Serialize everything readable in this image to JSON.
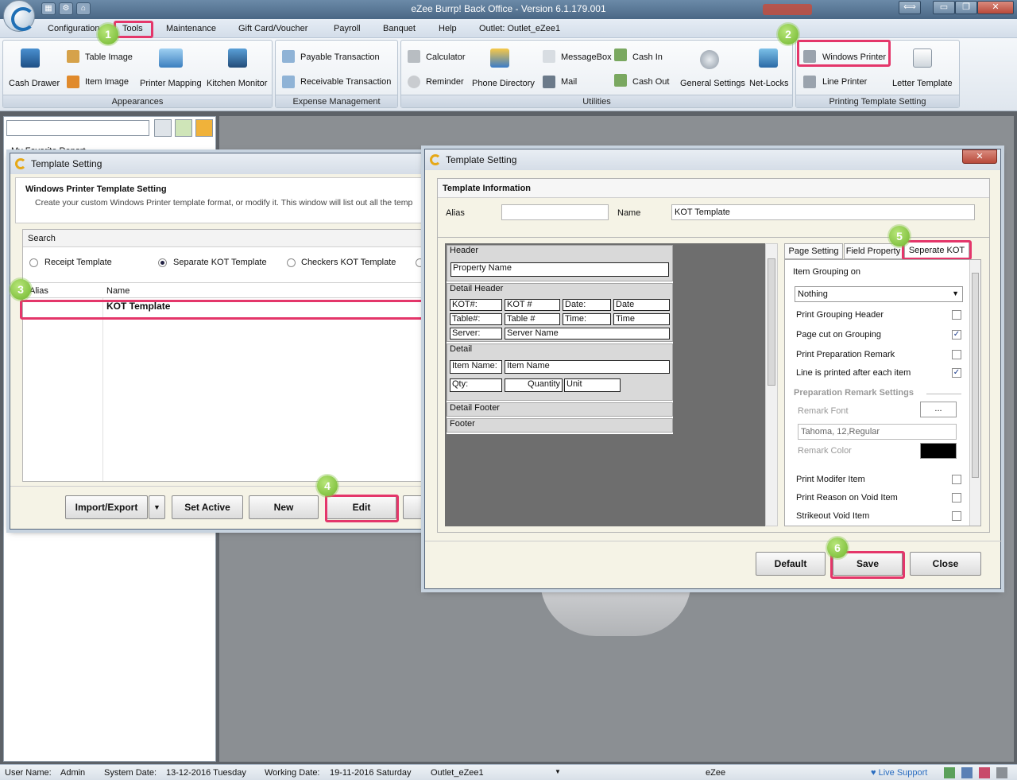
{
  "window": {
    "title": "eZee Burrp! Back Office - Version 6.1.179.001",
    "min": "▭",
    "restore": "❐",
    "close": "✕",
    "resize": "⟺"
  },
  "menubar": {
    "items": [
      "Configuration",
      "Tools",
      "Maintenance",
      "Gift Card/Voucher",
      "Payroll",
      "Banquet",
      "Help",
      "Outlet: Outlet_eZee1"
    ]
  },
  "ribbon": {
    "appearances": {
      "label": "Appearances",
      "items": [
        "Cash Drawer",
        "Table Image",
        "Item Image",
        "Printer Mapping",
        "Kitchen Monitor"
      ]
    },
    "expense": {
      "label": "Expense Management",
      "items": [
        "Payable Transaction",
        "Receivable Transaction"
      ]
    },
    "utilities": {
      "label": "Utilities",
      "items": [
        "Calculator",
        "Reminder",
        "Phone Directory",
        "MessageBox",
        "Mail",
        "Cash In",
        "Cash Out",
        "General Settings",
        "Net-Locks"
      ]
    },
    "printing": {
      "label": "Printing Template Setting",
      "items": [
        "Windows Printer",
        "Line Printer",
        "Letter Template"
      ]
    }
  },
  "left_panel": {
    "tree_item": "My Favorite Report"
  },
  "dialog1": {
    "title": "Template Setting",
    "heading": "Windows Printer Template Setting",
    "description": "Create your custom Windows Printer template format, or modify it. This window will list out all the temp",
    "search_label": "Search",
    "radios": [
      "Receipt Template",
      "Separate KOT Template",
      "Checkers KOT Template"
    ],
    "columns": [
      "Alias",
      "Name"
    ],
    "rows": [
      {
        "alias": "",
        "name": "KOT Template"
      }
    ],
    "buttons": [
      "Import/Export",
      "Set Active",
      "New",
      "Edit"
    ]
  },
  "dialog2": {
    "title": "Template Setting",
    "section": "Template Information",
    "alias_label": "Alias",
    "alias_value": "",
    "name_label": "Name",
    "name_value": "KOT Template",
    "template": {
      "header": "Header",
      "property_name": "Property Name",
      "detail_header": "Detail Header",
      "kot_label": "KOT#:",
      "kot_value": "KOT #",
      "date_label": "Date:",
      "date_value": "Date",
      "table_label": "Table#:",
      "table_value": "Table #",
      "time_label": "Time:",
      "time_value": "Time",
      "server_label": "Server:",
      "server_value": "Server Name",
      "detail": "Detail",
      "item_label": "Item Name:",
      "item_value": "Item Name",
      "qty_label": "Qty:",
      "qty_value": "Quantity",
      "unit_value": "Unit",
      "detail_footer": "Detail Footer",
      "footer": "Footer"
    },
    "tabs": [
      "Page Setting",
      "Field Property",
      "Seperate KOT"
    ],
    "props": {
      "grouping_label": "Item Grouping on",
      "grouping_value": "Nothing",
      "print_grouping_header": "Print Grouping Header",
      "page_cut": "Page cut on Grouping",
      "print_prep": "Print Preparation Remark",
      "line_printed": "Line is printed after each item",
      "prep_section": "Preparation Remark Settings",
      "remark_font": "Remark Font",
      "font_btn": "...",
      "font_value": "Tahoma, 12,Regular",
      "remark_color": "Remark Color",
      "print_modifier": "Print Modifer Item",
      "print_reason": "Print Reason on Void Item",
      "strikeout": "Strikeout Void Item"
    },
    "checks": {
      "print_grouping_header": false,
      "page_cut": true,
      "print_prep": false,
      "line_printed": true,
      "print_modifier": false,
      "print_reason": false,
      "strikeout": false
    },
    "buttons": [
      "Default",
      "Save",
      "Close"
    ]
  },
  "badges": [
    "1",
    "2",
    "3",
    "4",
    "5",
    "6"
  ],
  "status": {
    "user_label": "User Name:",
    "user": "Admin",
    "sysdate_label": "System Date:",
    "sysdate": "13-12-2016 Tuesday",
    "workdate_label": "Working Date:",
    "workdate": "19-11-2016 Saturday",
    "outlet": "Outlet_eZee1",
    "center": "eZee",
    "live_support": "Live Support"
  },
  "colors": {
    "highlight": "#e4366a",
    "badge": "#8cc84b",
    "titlebar": "#5a7898"
  }
}
